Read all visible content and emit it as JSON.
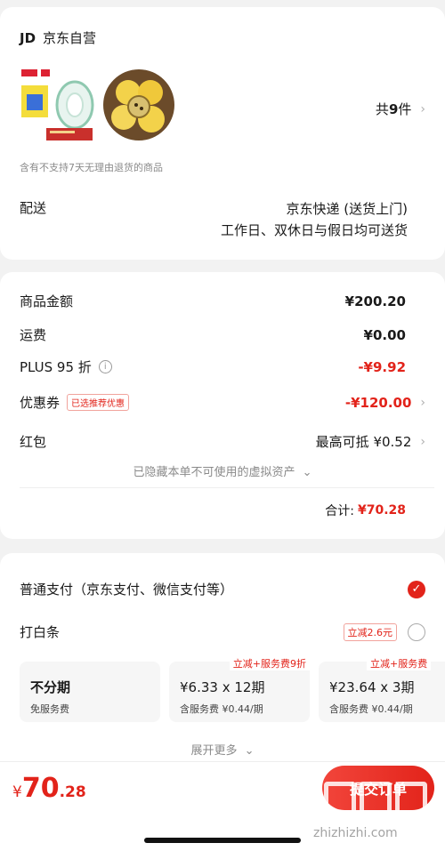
{
  "store": {
    "logo": "JD",
    "name": "京东自营"
  },
  "goods": {
    "count_prefix": "共",
    "count": "9",
    "count_suffix": "件",
    "notice": "含有不支持7天无理由退货的商品"
  },
  "delivery": {
    "label": "配送",
    "method": "京东快递 (送货上门)",
    "time": "工作日、双休日与假日均可送货"
  },
  "summary": {
    "goods_amount_label": "商品金额",
    "goods_amount": "¥200.20",
    "freight_label": "运费",
    "freight": "¥0.00",
    "plus_label": "PLUS 95 折",
    "plus_discount": "-¥9.92",
    "coupon_label": "优惠券",
    "coupon_tag": "已选推荐优惠",
    "coupon_discount": "-¥120.00",
    "redpacket_label": "红包",
    "redpacket_value": "最高可抵 ¥0.52",
    "hidden_assets": "已隐藏本单不可使用的虚拟资产",
    "total_label": "合计:",
    "total": "¥70.28"
  },
  "payment": {
    "normal_label": "普通支付（京东支付、微信支付等）",
    "baitiao_label": "打白条",
    "baitiao_tag": "立减2.6元",
    "installments": [
      {
        "badge": "",
        "main": "不分期",
        "sub": "免服务费"
      },
      {
        "badge": "立减+服务费9折",
        "main": "¥6.33 x 12期",
        "sub": "含服务费 ¥0.44/期"
      },
      {
        "badge": "立减+服务费",
        "main": "¥23.64 x 3期",
        "sub": "含服务费 ¥0.44/期"
      }
    ],
    "expand_more": "展开更多"
  },
  "footer": {
    "price_symbol": "¥",
    "price_int": "70",
    "price_dec": ".28",
    "submit_label": "提交订单"
  },
  "watermark": {
    "text": "zhizhizhi.com"
  },
  "colors": {
    "accent": "#e2231a",
    "background": "#f2f2f2"
  }
}
